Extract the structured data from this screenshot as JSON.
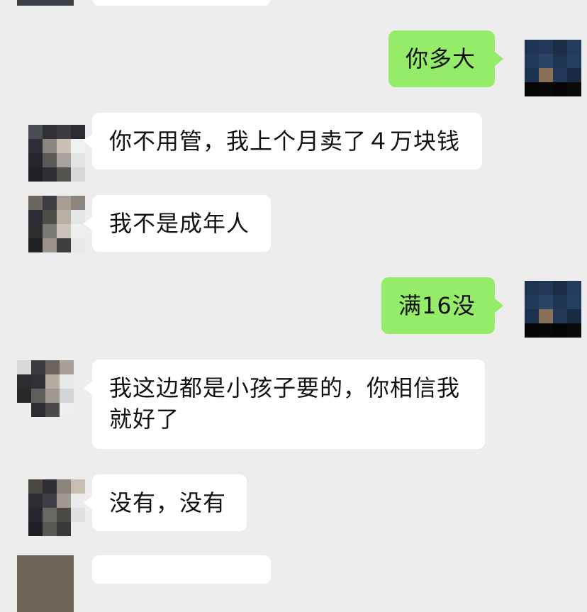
{
  "messages": [
    {
      "side": "out",
      "text": "你多大"
    },
    {
      "side": "in",
      "text": "你不用管，我上个月卖了４万块钱"
    },
    {
      "side": "in",
      "text": "我不是成年人"
    },
    {
      "side": "out",
      "text": "满16没"
    },
    {
      "side": "in",
      "text": "我这边都是小孩子要的，你相信我就好了"
    },
    {
      "side": "in",
      "text": "没有，没有"
    }
  ],
  "colors": {
    "background": "#ededed",
    "incoming_bubble": "#ffffff",
    "outgoing_bubble": "#95ec69"
  },
  "avatar_icons": {
    "incoming": "pixelated-avatar-icon",
    "outgoing": "pixelated-avatar-icon"
  }
}
